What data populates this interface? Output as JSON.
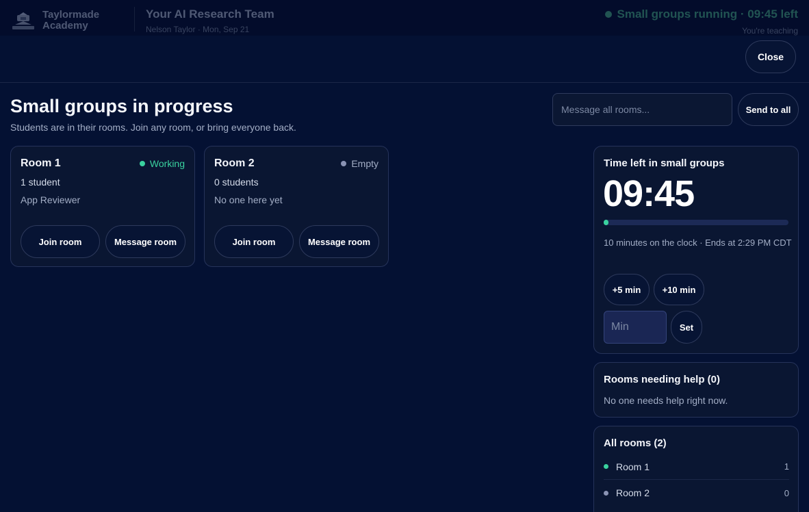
{
  "app": {
    "brand": "Taylormade Academy",
    "title": "Your AI Research Team",
    "subtitle": "Nelson Taylor · Mon, Sep 21",
    "status": "Small groups running · 09:45 left",
    "status_sub": "You're teaching",
    "status_color": "#3f9b7a"
  },
  "overlay": {
    "close_label": "Close",
    "title": "Small groups in progress",
    "subtitle": "Students are in their rooms. Join any room, or bring everyone back.",
    "message_placeholder": "Message all rooms...",
    "send_label": "Send to all"
  },
  "rooms": [
    {
      "name": "Room 1",
      "status": "Working",
      "status_color": "#3ad29f",
      "count": "1 student",
      "detail": "App Reviewer",
      "join_label": "Join room",
      "message_label": "Message room"
    },
    {
      "name": "Room 2",
      "status": "Empty",
      "status_color": "#8a93b4",
      "count": "0 students",
      "detail": "No one here yet",
      "join_label": "Join room",
      "message_label": "Message room"
    }
  ],
  "timer": {
    "heading": "Time left in small groups",
    "value": "09:45",
    "progress": 0.025,
    "info": "10 minutes on the clock · Ends at 2:29 PM CDT",
    "add5_label": "+5 min",
    "add10_label": "+10 min",
    "min_placeholder": "Min",
    "set_label": "Set",
    "accent": "#3ad29f"
  },
  "help": {
    "heading": "Rooms needing help (0)",
    "text": "No one needs help right now."
  },
  "all_rooms": {
    "heading": "All rooms (2)",
    "items": [
      {
        "name": "Room 1",
        "count": "1",
        "color": "#3ad29f"
      },
      {
        "name": "Room 2",
        "count": "0",
        "color": "#8a93b4"
      }
    ]
  }
}
